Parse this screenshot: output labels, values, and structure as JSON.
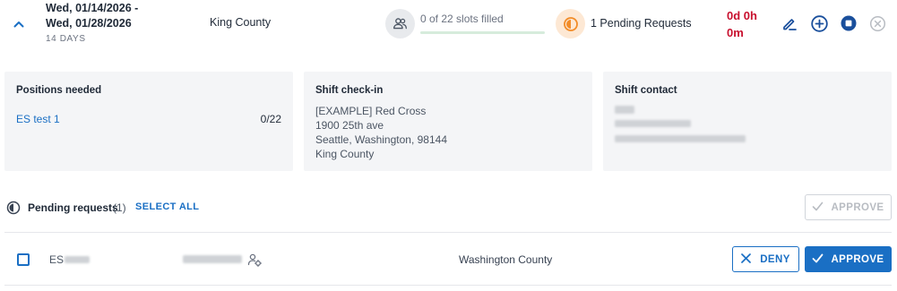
{
  "shift": {
    "date_range": "Wed, 01/14/2026 - Wed, 01/28/2026",
    "duration": "14 DAYS",
    "county": "King County",
    "slots_text": "0 of 22 slots filled",
    "slots_filled_fraction": 0,
    "pending_text": "1 Pending Requests",
    "timer_line1": "0d 0h",
    "timer_line2": "0m"
  },
  "icons": {
    "expand": "chevron-up-icon",
    "slots": "people-icon",
    "pending": "half-circle-clock-icon",
    "edit": "pencil-icon",
    "add": "plus-circle-icon",
    "stop": "stop-circle-icon",
    "cancel": "close-circle-icon"
  },
  "cards": {
    "positions": {
      "title": "Positions needed",
      "items": [
        {
          "name": "ES test 1",
          "count": "0/22"
        }
      ]
    },
    "checkin": {
      "title": "Shift check-in",
      "address_lines": [
        "[EXAMPLE] Red Cross",
        "1900 25th ave",
        "Seattle, Washington, 98144",
        "King County"
      ]
    },
    "contact": {
      "title": "Shift contact"
    }
  },
  "pending": {
    "title": "Pending requests",
    "count": "(1)",
    "select_all": "SELECT ALL",
    "approve_all_label": "APPROVE",
    "rows": [
      {
        "id_prefix": "ES",
        "county": "Washington County",
        "deny_label": "DENY",
        "approve_label": "APPROVE"
      }
    ]
  },
  "colors": {
    "primary": "#1a6fc4",
    "timer_red": "#c8102e",
    "pending_orange": "#f28c28",
    "progress_green": "#3fa55d",
    "card_bg": "#f4f5f7"
  }
}
